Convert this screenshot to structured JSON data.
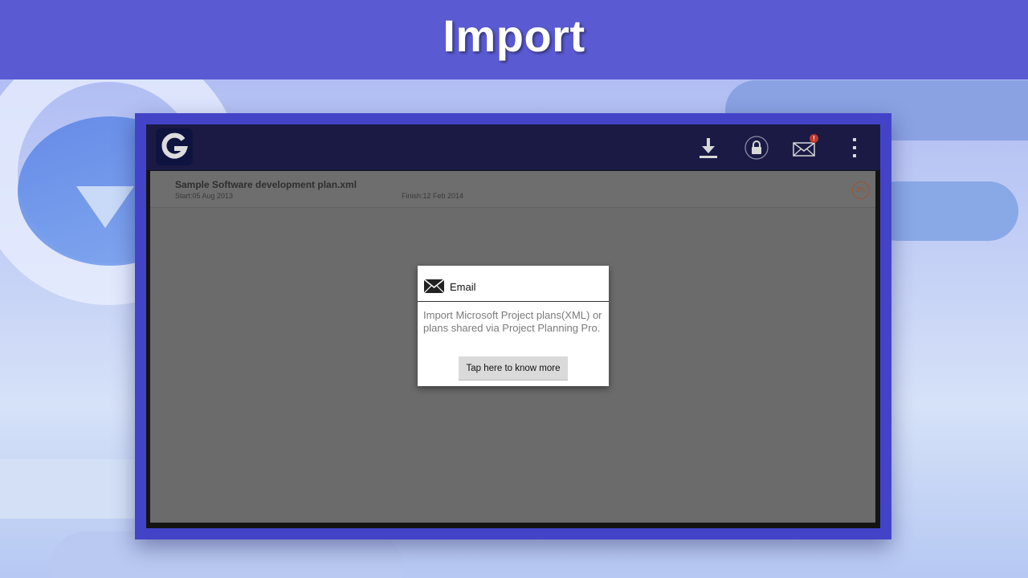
{
  "banner": {
    "title": "Import"
  },
  "app": {
    "logo_letter": "G",
    "toolbar": {
      "download_icon": "download-icon",
      "lock_icon": "lock-icon",
      "mail_icon": "mail-icon",
      "mail_badge": "!",
      "menu_icon": "overflow-menu-icon"
    },
    "plan": {
      "name": "Sample Software development plan.xml",
      "start": "Start:05 Aug 2013",
      "finish": "Finish:12 Feb 2014",
      "progress": "2%"
    },
    "dialog": {
      "title": "Email",
      "body": "Import Microsoft Project plans(XML) or plans shared via Project Planning Pro.",
      "button": "Tap here to know more"
    }
  },
  "colors": {
    "banner": "#5a5ad3",
    "frame": "#4343c8",
    "appbar": "#1a1a45",
    "content": "#6b6b6b"
  }
}
